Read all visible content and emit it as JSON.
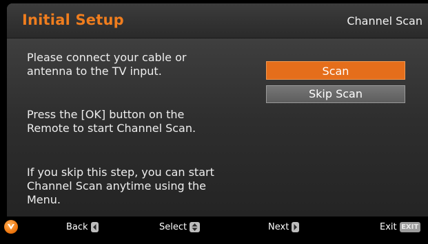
{
  "header": {
    "title": "Initial Setup",
    "breadcrumb": "Channel Scan"
  },
  "instructions": {
    "connect": "Please connect your cable or\nantenna to the TV input.",
    "press_ok": "Press the [OK] button on the\nRemote to start Channel Scan.",
    "skip_info": "If you skip this step, you can start\nChannel Scan anytime using the\nMenu."
  },
  "actions": {
    "scan_label": "Scan",
    "skip_label": "Skip Scan",
    "selected": "Scan"
  },
  "footer": {
    "logo_icon": "brand-logo-icon",
    "back_label": "Back",
    "back_icon": "arrow-left-key-icon",
    "select_label": "Select",
    "select_icon": "up-down-key-icon",
    "next_label": "Next",
    "next_icon": "arrow-right-key-icon",
    "exit_label": "Exit",
    "exit_key": "EXIT"
  },
  "colors": {
    "accent": "#ef7d1e",
    "button_selected": "#e56e1b",
    "button_normal": "#6a6a6a"
  }
}
